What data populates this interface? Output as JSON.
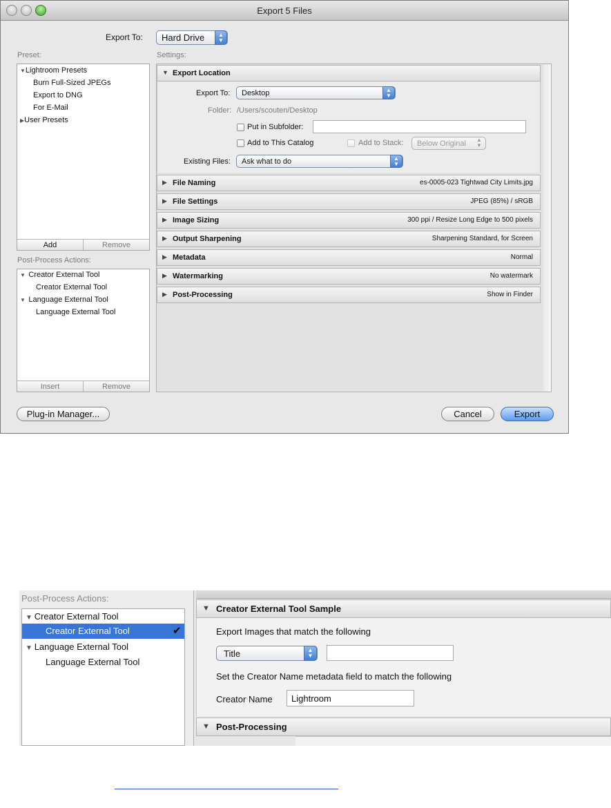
{
  "window": {
    "title": "Export 5 Files",
    "export_to_label": "Export To:",
    "export_to_value": "Hard Drive",
    "preset_label": "Preset:",
    "settings_label": "Settings:",
    "presets": [
      {
        "label": "Lightroom Presets",
        "expanded": true
      },
      {
        "label": "Burn Full-Sized JPEGs"
      },
      {
        "label": "Export to DNG"
      },
      {
        "label": "For E-Mail"
      },
      {
        "label": "User Presets",
        "expanded": false
      }
    ],
    "preset_add": "Add",
    "preset_remove": "Remove",
    "post_process_label": "Post-Process Actions:",
    "post_actions": [
      {
        "label": "Creator External Tool",
        "expanded": true
      },
      {
        "label": "Creator External Tool"
      },
      {
        "label": "Language External Tool",
        "expanded": true
      },
      {
        "label": "Language External Tool"
      }
    ],
    "post_insert": "Insert",
    "post_remove": "Remove",
    "export_location": {
      "title": "Export Location",
      "export_to_label": "Export To:",
      "export_to_value": "Desktop",
      "folder_label": "Folder:",
      "folder_value": "/Users/scouten/Desktop",
      "put_in_subfolder": "Put in Subfolder:",
      "add_to_catalog": "Add to This Catalog",
      "add_to_stack": "Add to Stack:",
      "stack_value": "Below Original",
      "existing_files_label": "Existing Files:",
      "existing_files_value": "Ask what to do"
    },
    "panels": [
      {
        "title": "File Naming",
        "summary": "es-0005-023 Tightwad City Limits.jpg"
      },
      {
        "title": "File Settings",
        "summary": "JPEG (85%) / sRGB"
      },
      {
        "title": "Image Sizing",
        "summary": "300 ppi / Resize Long Edge to 500 pixels"
      },
      {
        "title": "Output Sharpening",
        "summary": "Sharpening Standard, for Screen"
      },
      {
        "title": "Metadata",
        "summary": "Normal"
      },
      {
        "title": "Watermarking",
        "summary": "No watermark"
      },
      {
        "title": "Post-Processing",
        "summary": "Show in Finder"
      }
    ],
    "plugin_manager": "Plug-in Manager...",
    "cancel": "Cancel",
    "export": "Export"
  },
  "zoom": {
    "post_process_label": "Post-Process Actions:",
    "actions": [
      {
        "label": "Creator External Tool",
        "expanded": true
      },
      {
        "label": "Creator External Tool",
        "selected": true
      },
      {
        "label": "Language External Tool",
        "expanded": true
      },
      {
        "label": "Language External Tool"
      }
    ],
    "sample_title": "Creator External Tool Sample",
    "match_text": "Export Images that match the following",
    "field_select": "Title",
    "set_text": "Set the Creator Name metadata field to match the following",
    "creator_label": "Creator Name",
    "creator_value": "Lightroom",
    "post_processing_title": "Post-Processing"
  },
  "colors": {
    "selection": "#3875d7",
    "accent_blue": "#5b9cf0"
  }
}
